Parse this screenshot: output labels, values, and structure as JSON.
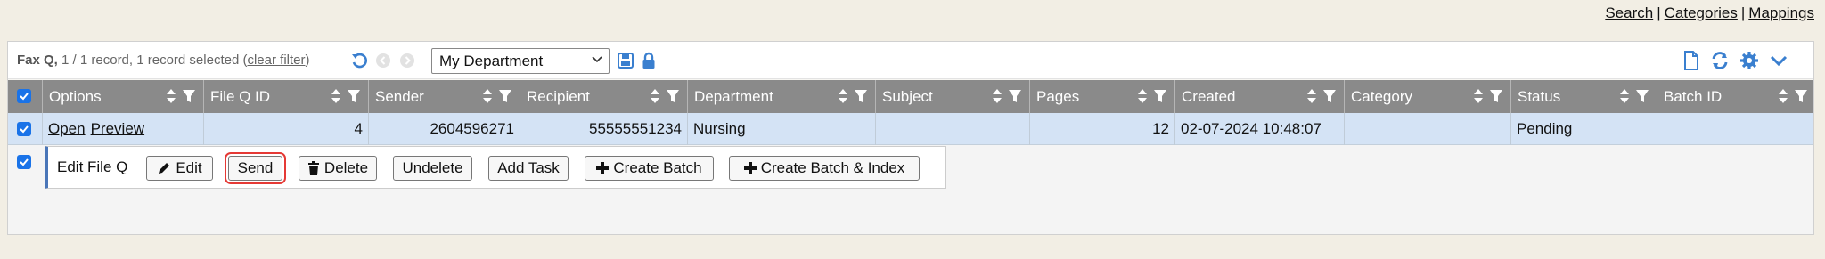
{
  "top_links": {
    "search": "Search",
    "categories": "Categories",
    "mappings": "Mappings",
    "sep": "|"
  },
  "toolbar": {
    "queue_name": "Fax Q,",
    "record_info": "1 / 1 record, 1 record selected (",
    "clear_filter": "clear filter",
    "close_paren": ")",
    "department_select": "My Department"
  },
  "columns": [
    {
      "label": "Options"
    },
    {
      "label": "File Q ID"
    },
    {
      "label": "Sender"
    },
    {
      "label": "Recipient"
    },
    {
      "label": "Department"
    },
    {
      "label": "Subject"
    },
    {
      "label": "Pages"
    },
    {
      "label": "Created"
    },
    {
      "label": "Category"
    },
    {
      "label": "Status"
    },
    {
      "label": "Batch ID"
    }
  ],
  "row": {
    "open": "Open",
    "preview": "Preview",
    "file_q_id": "4",
    "sender": "2604596271",
    "recipient": "55555551234",
    "department": "Nursing",
    "subject": "",
    "pages": "12",
    "created": "02-07-2024 10:48:07",
    "category": "",
    "status": "Pending",
    "batch_id": ""
  },
  "edit_panel": {
    "title": "Edit File Q",
    "edit": "Edit",
    "send": "Send",
    "delete": "Delete",
    "undelete": "Undelete",
    "add_task": "Add Task",
    "create_batch": "Create Batch",
    "create_batch_index": "Create Batch & Index"
  },
  "colors": {
    "accent": "#3a7fcf",
    "header_bg": "#8a8a8a",
    "selected_row": "#d4e3f5",
    "highlight": "#e53935"
  }
}
